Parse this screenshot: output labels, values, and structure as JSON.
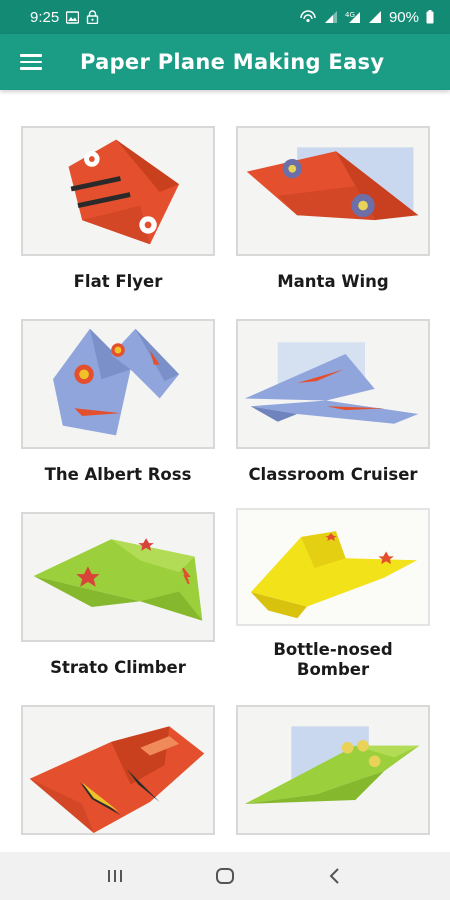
{
  "status_bar": {
    "time": "9:25",
    "battery": "90%",
    "icons_left": [
      "image-icon",
      "lock-icon"
    ],
    "icons_right": [
      "hotspot-icon",
      "signal-icon",
      "data-signal-icon",
      "signal-icon-2",
      "battery-icon"
    ]
  },
  "app_bar": {
    "title": "Paper Plane Making Easy",
    "menu_icon": "hamburger-menu-icon"
  },
  "planes": [
    {
      "label": "Flat Flyer",
      "color": "#e4502e"
    },
    {
      "label": "Manta Wing",
      "color": "#e4502e"
    },
    {
      "label": "The Albert Ross",
      "color": "#8fa5dc"
    },
    {
      "label": "Classroom Cruiser",
      "color": "#8fa5dc"
    },
    {
      "label": "Strato Climber",
      "color": "#9ccf3c"
    },
    {
      "label": "Bottle-nosed\nBomber",
      "color": "#f2e21a"
    },
    {
      "label": "",
      "color": "#e4502e"
    },
    {
      "label": "",
      "color": "#9ccf3c"
    }
  ],
  "nav_bar": {
    "recents_icon": "recents-icon",
    "home_icon": "home-icon",
    "back_icon": "back-icon"
  }
}
